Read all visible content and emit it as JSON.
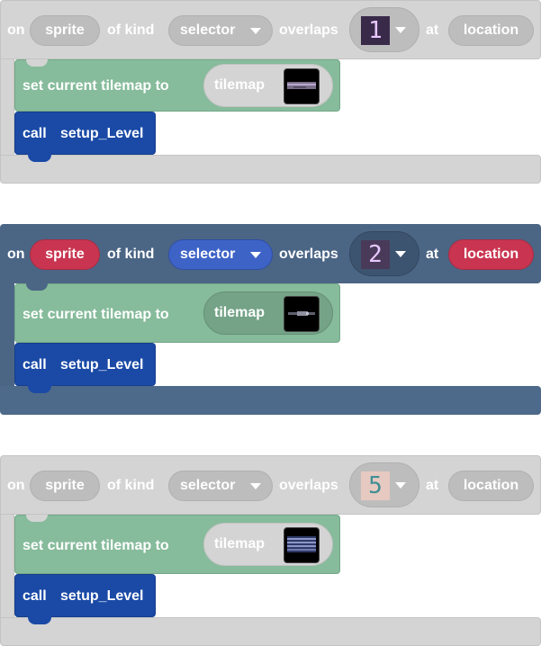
{
  "blocks": [
    {
      "theme": "gray",
      "on": "on",
      "sprite": "sprite",
      "of_kind": "of kind",
      "kind": "selector",
      "overlaps": "overlaps",
      "tile_number": "1",
      "at": "at",
      "location": "location",
      "set_label": "set current tilemap to",
      "tilemap_label": "tilemap",
      "call_label": "call",
      "function_name": "setup_Level"
    },
    {
      "theme": "blue",
      "on": "on",
      "sprite": "sprite",
      "of_kind": "of kind",
      "kind": "selector",
      "overlaps": "overlaps",
      "tile_number": "2",
      "at": "at",
      "location": "location",
      "set_label": "set current tilemap to",
      "tilemap_label": "tilemap",
      "call_label": "call",
      "function_name": "setup_Level"
    },
    {
      "theme": "gray",
      "on": "on",
      "sprite": "sprite",
      "of_kind": "of kind",
      "kind": "selector",
      "overlaps": "overlaps",
      "tile_number": "5",
      "at": "at",
      "location": "location",
      "set_label": "set current tilemap to",
      "tilemap_label": "tilemap",
      "call_label": "call",
      "function_name": "setup_Level"
    }
  ],
  "colors": {
    "disabled_gray": "#d4d4d4",
    "event_blue": "#4b6585",
    "sprite_red": "#c93550",
    "kind_blue": "#3e63c7",
    "tilemap_green": "#86bb9b",
    "call_navy": "#1a4aa6"
  }
}
